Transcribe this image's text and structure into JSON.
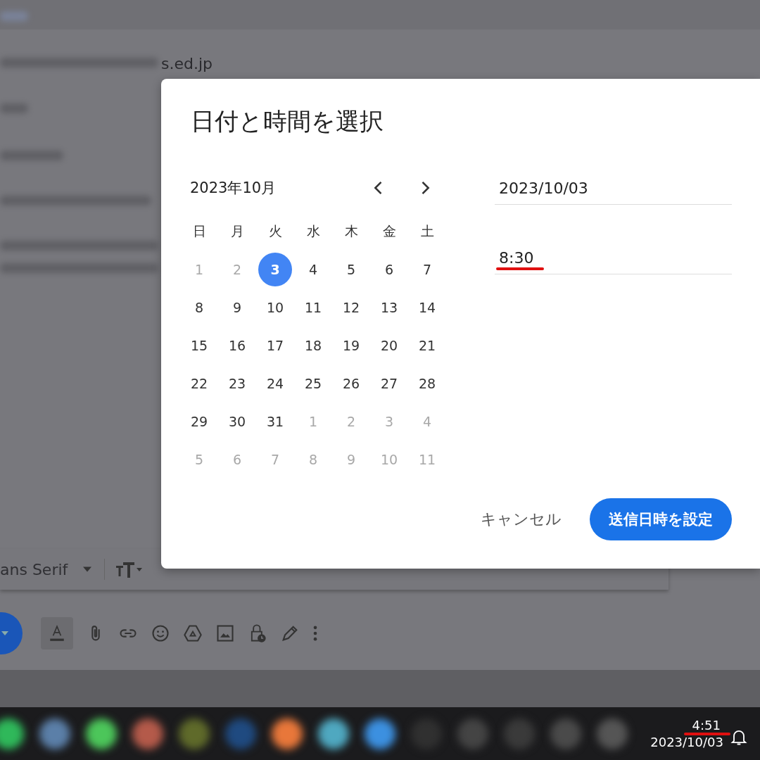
{
  "background": {
    "recipient_text": "s.ed.jp",
    "font_name": "ans Serif"
  },
  "dialog": {
    "title": "日付と時間を選択",
    "month_label": "2023年10月",
    "weekdays": [
      "日",
      "月",
      "火",
      "水",
      "木",
      "金",
      "土"
    ],
    "days": [
      {
        "label": "1",
        "muted": true,
        "selected": false
      },
      {
        "label": "2",
        "muted": true,
        "selected": false
      },
      {
        "label": "3",
        "muted": false,
        "selected": true
      },
      {
        "label": "4",
        "muted": false,
        "selected": false
      },
      {
        "label": "5",
        "muted": false,
        "selected": false
      },
      {
        "label": "6",
        "muted": false,
        "selected": false
      },
      {
        "label": "7",
        "muted": false,
        "selected": false
      },
      {
        "label": "8",
        "muted": false,
        "selected": false
      },
      {
        "label": "9",
        "muted": false,
        "selected": false
      },
      {
        "label": "10",
        "muted": false,
        "selected": false
      },
      {
        "label": "11",
        "muted": false,
        "selected": false
      },
      {
        "label": "12",
        "muted": false,
        "selected": false
      },
      {
        "label": "13",
        "muted": false,
        "selected": false
      },
      {
        "label": "14",
        "muted": false,
        "selected": false
      },
      {
        "label": "15",
        "muted": false,
        "selected": false
      },
      {
        "label": "16",
        "muted": false,
        "selected": false
      },
      {
        "label": "17",
        "muted": false,
        "selected": false
      },
      {
        "label": "18",
        "muted": false,
        "selected": false
      },
      {
        "label": "19",
        "muted": false,
        "selected": false
      },
      {
        "label": "20",
        "muted": false,
        "selected": false
      },
      {
        "label": "21",
        "muted": false,
        "selected": false
      },
      {
        "label": "22",
        "muted": false,
        "selected": false
      },
      {
        "label": "23",
        "muted": false,
        "selected": false
      },
      {
        "label": "24",
        "muted": false,
        "selected": false
      },
      {
        "label": "25",
        "muted": false,
        "selected": false
      },
      {
        "label": "26",
        "muted": false,
        "selected": false
      },
      {
        "label": "27",
        "muted": false,
        "selected": false
      },
      {
        "label": "28",
        "muted": false,
        "selected": false
      },
      {
        "label": "29",
        "muted": false,
        "selected": false
      },
      {
        "label": "30",
        "muted": false,
        "selected": false
      },
      {
        "label": "31",
        "muted": false,
        "selected": false
      },
      {
        "label": "1",
        "muted": true,
        "selected": false
      },
      {
        "label": "2",
        "muted": true,
        "selected": false
      },
      {
        "label": "3",
        "muted": true,
        "selected": false
      },
      {
        "label": "4",
        "muted": true,
        "selected": false
      },
      {
        "label": "5",
        "muted": true,
        "selected": false
      },
      {
        "label": "6",
        "muted": true,
        "selected": false
      },
      {
        "label": "7",
        "muted": true,
        "selected": false
      },
      {
        "label": "8",
        "muted": true,
        "selected": false
      },
      {
        "label": "9",
        "muted": true,
        "selected": false
      },
      {
        "label": "10",
        "muted": true,
        "selected": false
      },
      {
        "label": "11",
        "muted": true,
        "selected": false
      }
    ],
    "date_value": "2023/10/03",
    "time_value": "8:30",
    "time_underlined": true,
    "cancel_label": "キャンセル",
    "confirm_label": "送信日時を設定"
  },
  "taskbar": {
    "time": "4:51",
    "date": "2023/10/03",
    "time_underlined": true
  }
}
